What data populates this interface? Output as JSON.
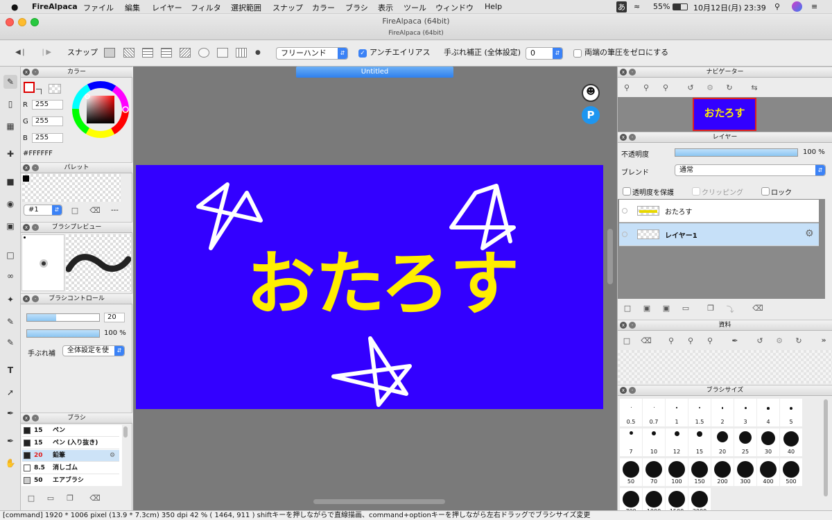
{
  "menubar": {
    "apple": "",
    "app": "FireAlpaca",
    "items": [
      "ファイル",
      "編集",
      "レイヤー",
      "フィルタ",
      "選択範囲",
      "スナップ",
      "カラー",
      "ブラシ",
      "表示",
      "ツール",
      "ウィンドウ",
      "Help"
    ],
    "ime": "あ",
    "battery": "55%",
    "datetime": "10月12日(月)  23:39"
  },
  "window": {
    "title": "FireAlpaca (64bit)",
    "subtitle": "FireAlpaca (64bit)"
  },
  "toolbar": {
    "snap_label": "スナップ",
    "stroke_mode": "フリーハンド",
    "antialias_label": "アンチエイリアス",
    "antialias_checked": true,
    "stabilizer_label": "手ぶれ補正 (全体設定)",
    "stabilizer_value": "0",
    "zero_pressure_label": "両端の筆圧をゼロにする",
    "zero_pressure_checked": false
  },
  "color_panel": {
    "title": "カラー",
    "r_label": "R",
    "r": "255",
    "g_label": "G",
    "g": "255",
    "b_label": "B",
    "b": "255",
    "hex": "#FFFFFF"
  },
  "palette_panel": {
    "title": "パレット",
    "selected": "#1",
    "extra": "---"
  },
  "brush_preview_panel": {
    "title": "ブラシプレビュー"
  },
  "brush_control_panel": {
    "title": "ブラシコントロール",
    "size": "20",
    "size_fraction": 0.4,
    "opacity": "100 %",
    "opacity_fraction": 1.0,
    "stabilizer_label": "手ぶれ補",
    "stabilizer_value": "全体設定を使"
  },
  "brush_panel": {
    "title": "ブラシ",
    "items": [
      {
        "size": "15",
        "name": "ペン",
        "color": "#222222"
      },
      {
        "size": "15",
        "name": "ペン (入り抜き)",
        "color": "#222222"
      },
      {
        "size": "20",
        "name": "鉛筆",
        "color": "#222222",
        "active": true
      },
      {
        "size": "8.5",
        "name": "消しゴム",
        "color": "#ffffff"
      },
      {
        "size": "50",
        "name": "エアブラシ",
        "color": "#cccccc"
      }
    ]
  },
  "canvas": {
    "tab": "Untitled",
    "text": "おたろす",
    "bg_color": "#3300ff",
    "text_color": "#ffee00"
  },
  "navigator_panel": {
    "title": "ナビゲーター",
    "thumb_text": "おたろす"
  },
  "layer_panel": {
    "title": "レイヤー",
    "opacity_label": "不透明度",
    "opacity_value": "100 %",
    "opacity_fraction": 1.0,
    "blend_label": "ブレンド",
    "blend_value": "通常",
    "protect_label": "透明度を保護",
    "clipping_label": "クリッピング",
    "lock_label": "ロック",
    "layers": [
      {
        "name": "おたろす",
        "selected": false
      },
      {
        "name": "レイヤー1",
        "selected": true
      }
    ]
  },
  "material_panel": {
    "title": "資料"
  },
  "brush_size_panel": {
    "title": "ブラシサイズ",
    "sizes": [
      "0.5",
      "0.7",
      "1",
      "1.5",
      "2",
      "3",
      "4",
      "5",
      "7",
      "10",
      "12",
      "15",
      "20",
      "25",
      "30",
      "40",
      "50",
      "70",
      "100",
      "150",
      "200",
      "300",
      "400",
      "500",
      "700",
      "1000",
      "1500",
      "2000"
    ]
  },
  "statusbar": {
    "text": "[command]   1920 * 1006 pixel   (13.9 * 7.3cm)   350 dpi   42 %   ( 1464, 911 )   shiftキーを押しながらで直線描画、command+optionキーを押しながら左右ドラッグでブラシサイズ変更"
  }
}
